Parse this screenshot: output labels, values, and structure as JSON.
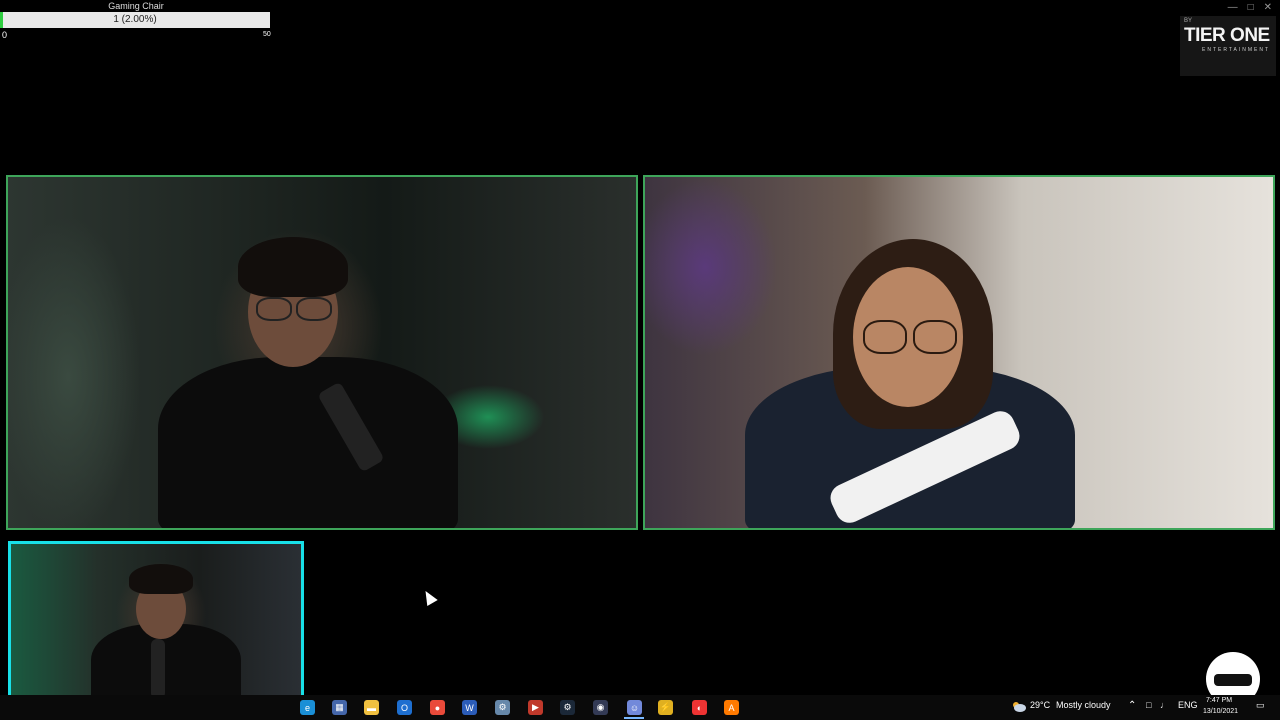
{
  "goal": {
    "title": "Gaming Chair",
    "progress_text": "1 (2.00%)",
    "progress_fraction": 0.02,
    "min_label": "0",
    "max_label": "50",
    "fill_color": "#2ecc40"
  },
  "logo": {
    "by": "BY",
    "main": "TIER ONE",
    "sub": "ENTERTAINMENT"
  },
  "cameras": [
    {
      "name": "main-cam-host",
      "border_color": "#3ea55a"
    },
    {
      "name": "guest-cam",
      "border_color": "#3ea55a"
    },
    {
      "name": "small-cam-host",
      "border_color": "#18e0e8"
    }
  ],
  "taskbar": {
    "icons": [
      "edge-icon",
      "store-icon",
      "file-explorer-icon",
      "outlook-icon",
      "chrome-icon",
      "word-icon",
      "app-icon",
      "twitch-studio-icon",
      "steam-icon",
      "obs-icon",
      "discord-icon",
      "thunder-icon",
      "davinci-icon",
      "illustrator-icon"
    ],
    "weather_temp": "29°C",
    "weather_text": "Mostly cloudy",
    "language": "ENG",
    "time": "7:47 PM",
    "date": "13/10/2021"
  }
}
